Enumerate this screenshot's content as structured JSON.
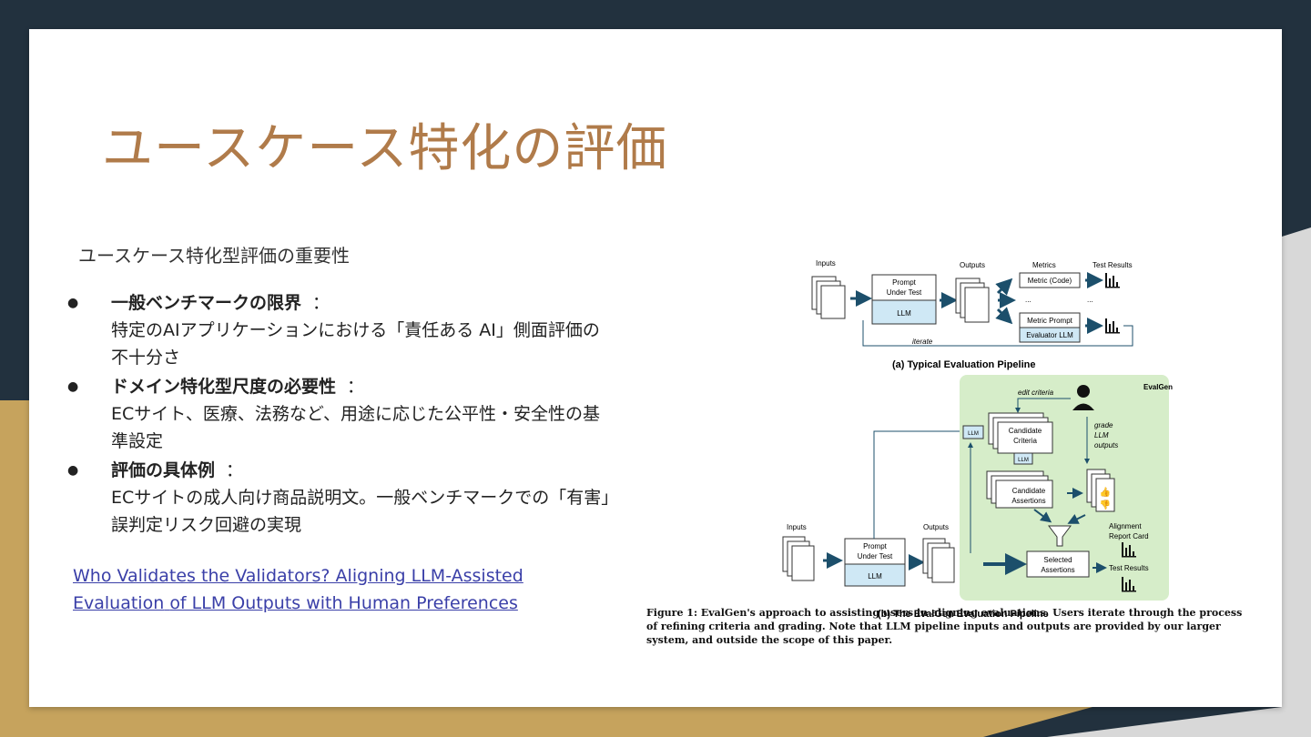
{
  "slide": {
    "title": "ユースケース特化の評価",
    "subtitle": "ユースケース特化型評価の重要性",
    "bullets": [
      {
        "head": "一般ベンチマークの限界",
        "sep": "：",
        "body": "特定のAIアプリケーションにおける「責任ある AI」側面評価の不十分さ"
      },
      {
        "head": "ドメイン特化型尺度の必要性",
        "sep": "：",
        "body": "ECサイト、医療、法務など、用途に応じた公平性・安全性の基準設定"
      },
      {
        "head": "評価の具体例",
        "sep": "：",
        "body": "ECサイトの成人向け商品説明文。一般ベンチマークでの「有害」誤判定リスク回避の実現"
      }
    ],
    "link_part1": "Who Validates the Validators? Aligning LLM-Assisted Evaluation",
    "link_part2": "of LLM Outputs with Human Preferences"
  },
  "figure": {
    "a": {
      "inputs": "Inputs",
      "prompt_under_test": [
        "Prompt",
        "Under Test"
      ],
      "llm": "LLM",
      "outputs": "Outputs",
      "metrics": "Metrics",
      "test_results": "Test Results",
      "metric_code": "Metric (Code)",
      "ellipsis": "...",
      "metric_prompt": "Metric Prompt",
      "evaluator_llm": "Evaluator LLM",
      "iterate": "iterate",
      "caption": "(a) Typical Evaluation Pipeline"
    },
    "b": {
      "evalgen": "EvalGen",
      "edit_criteria": "edit criteria",
      "llm": "LLM",
      "candidate_criteria": [
        "Candidate",
        "Criteria"
      ],
      "candidate_assertions": [
        "Candidate",
        "Assertions"
      ],
      "grade": [
        "grade",
        "LLM",
        "outputs"
      ],
      "alignment": [
        "Alignment",
        "Report Card"
      ],
      "inputs": "Inputs",
      "prompt_under_test": [
        "Prompt",
        "Under Test"
      ],
      "outputs": "Outputs",
      "selected_assertions": [
        "Selected",
        "Assertions"
      ],
      "test_results": "Test Results",
      "caption": "(b) The EvalGen Evaluation Pipeline"
    },
    "figure_caption": "Figure 1: EvalGen's approach to assisting users in aligning evaluations. Users iterate through the process of refining criteria and grading. Note that LLM pipeline inputs and outputs are provided by our larger system, and outside the scope of this paper."
  },
  "colors": {
    "title": "#b07b4a",
    "background_dark": "#22313e",
    "gold": "#c6a35d",
    "llm_box": "#cfe8f5",
    "evalgen_bg": "#d6edc9",
    "arrow": "#1c4f6b",
    "link": "#3a3fa8"
  }
}
